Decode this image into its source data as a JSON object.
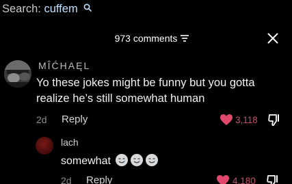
{
  "search": {
    "label": "Search:",
    "term": "cuffem"
  },
  "header": {
    "comment_count": "973 comments"
  },
  "comments": [
    {
      "username": "MÎĆHAĘL",
      "text": "Yo these jokes might be funny but you gotta realize he’s still somewhat human",
      "time": "2d",
      "reply_label": "Reply",
      "likes": "3,118",
      "accent_color": "#e0476b"
    },
    {
      "username": "lach",
      "text": "somewhat",
      "emojis": [
        "smiling-face-with-tear",
        "smiling-face-with-tear",
        "smiling-face-with-tear"
      ],
      "time": "2d",
      "reply_label": "Reply",
      "likes": "4,180",
      "accent_color": "#e0476b"
    }
  ]
}
